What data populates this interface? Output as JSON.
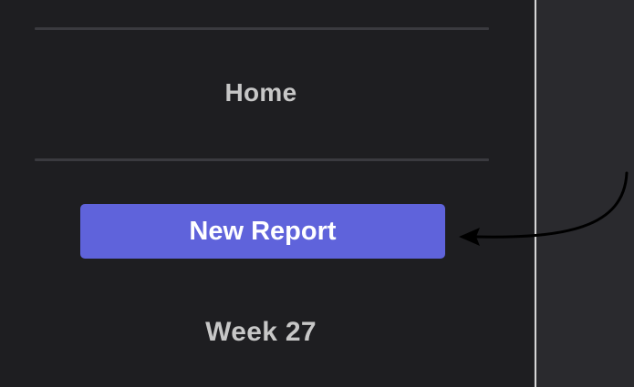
{
  "sidebar": {
    "nav": {
      "home_label": "Home",
      "new_report_label": "New Report",
      "week_label": "Week 27"
    }
  },
  "annotation": {
    "pointer_target": "new-report-button",
    "arrow_color": "#000000"
  },
  "colors": {
    "sidebar_bg": "#1e1e21",
    "panel_bg": "#2a2a2e",
    "accent": "#5f63db",
    "text_muted": "#c7c7c7"
  }
}
